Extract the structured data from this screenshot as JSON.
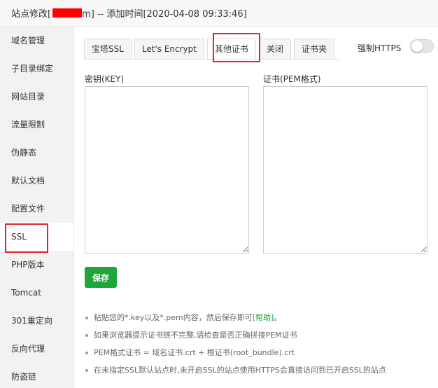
{
  "title": {
    "prefix": "站点修改[",
    "suffix": "m] -- 添加时间[2020-04-08 09:33:46]"
  },
  "sidebar": {
    "items": [
      {
        "label": "域名管理"
      },
      {
        "label": "子目录绑定"
      },
      {
        "label": "网站目录"
      },
      {
        "label": "流量限制"
      },
      {
        "label": "伪静态"
      },
      {
        "label": "默认文档"
      },
      {
        "label": "配置文件"
      },
      {
        "label": "SSL"
      },
      {
        "label": "PHP版本"
      },
      {
        "label": "Tomcat"
      },
      {
        "label": "301重定向"
      },
      {
        "label": "反向代理"
      },
      {
        "label": "防盗链"
      }
    ],
    "active": "SSL"
  },
  "tabs": [
    {
      "label": "宝塔SSL"
    },
    {
      "label": "Let's Encrypt"
    },
    {
      "label": "其他证书"
    },
    {
      "label": "关闭"
    },
    {
      "label": "证书夹"
    }
  ],
  "active_tab": "其他证书",
  "force_https": {
    "label": "强制HTTPS",
    "enabled": false
  },
  "key_field": {
    "label": "密钥(KEY)",
    "value": ""
  },
  "cert_field": {
    "label": "证书(PEM格式)",
    "value": ""
  },
  "save_label": "保存",
  "tips": {
    "t1_text": "粘贴您的*.key以及*.pem内容，然后保存即可",
    "t1_help": "[帮助]",
    "t1_end": "。",
    "t2": "如果浏览器提示证书链不完整,请检查是否正确拼接PEM证书",
    "t3": "PEM格式证书 = 域名证书.crt + 根证书(root_bundle).crt",
    "t4": "在未指定SSL默认站点时,未开启SSL的站点使用HTTPS会直接访问到已开启SSL的站点"
  },
  "colors": {
    "accent": "#20a53a",
    "highlight": "#e1252b",
    "redaction": "#ff0000"
  }
}
